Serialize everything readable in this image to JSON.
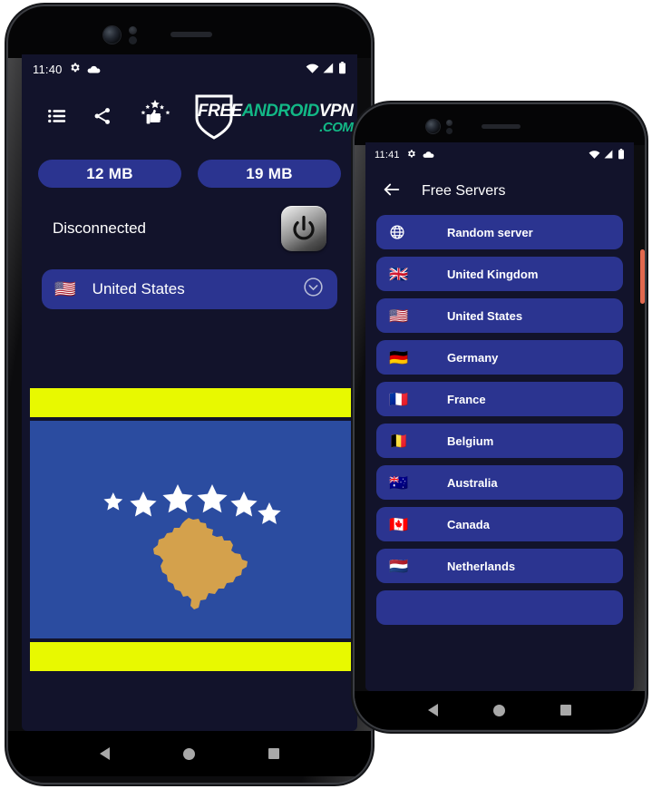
{
  "brand": {
    "accent_blue": "#2b3490",
    "bg_navy": "#12132b",
    "logo_green": "#12b886",
    "logo_part1": "FREE",
    "logo_part2": "ANDROID",
    "logo_part3": "VPN",
    "logo_part4": ".COM"
  },
  "phone1": {
    "status_bar": {
      "time": "11:40",
      "icons_left": [
        "gear-icon",
        "cloud-icon"
      ],
      "icons_right": [
        "wifi-icon",
        "signal-icon",
        "battery-icon"
      ]
    },
    "toolbar_icons": [
      "list-menu-icon",
      "share-icon",
      "rate-us-icon"
    ],
    "stats": {
      "download_label": "12 MB",
      "upload_label": "19 MB"
    },
    "connection_status": "Disconnected",
    "power_button_label": "power-icon",
    "country_selector": {
      "flag": "🇺🇸",
      "name": "United States",
      "chevron": "chevron-down-icon"
    },
    "banner": {
      "kind": "kosovo-flag",
      "band_color": "#e8f900",
      "flag_blue": "#2b4ca0",
      "map_gold": "#d4a14c",
      "stars": 6
    },
    "navigation": [
      "back",
      "home",
      "recents"
    ]
  },
  "phone2": {
    "status_bar": {
      "time": "11:41",
      "icons_left": [
        "gear-icon",
        "cloud-icon"
      ],
      "icons_right": [
        "wifi-icon",
        "signal-icon",
        "battery-icon"
      ]
    },
    "appbar": {
      "back": "back-arrow-icon",
      "title": "Free Servers"
    },
    "servers": [
      {
        "flag": "globe-icon",
        "name": "Random server"
      },
      {
        "flag": "🇬🇧",
        "name": "United Kingdom"
      },
      {
        "flag": "🇺🇸",
        "name": "United States"
      },
      {
        "flag": "🇩🇪",
        "name": "Germany"
      },
      {
        "flag": "🇫🇷",
        "name": "France"
      },
      {
        "flag": "🇧🇪",
        "name": "Belgium"
      },
      {
        "flag": "🇦🇺",
        "name": "Australia"
      },
      {
        "flag": "🇨🇦",
        "name": "Canada"
      },
      {
        "flag": "🇳🇱",
        "name": "Netherlands"
      },
      {
        "flag": "",
        "name": ""
      }
    ],
    "navigation": [
      "back",
      "home",
      "recents"
    ]
  }
}
